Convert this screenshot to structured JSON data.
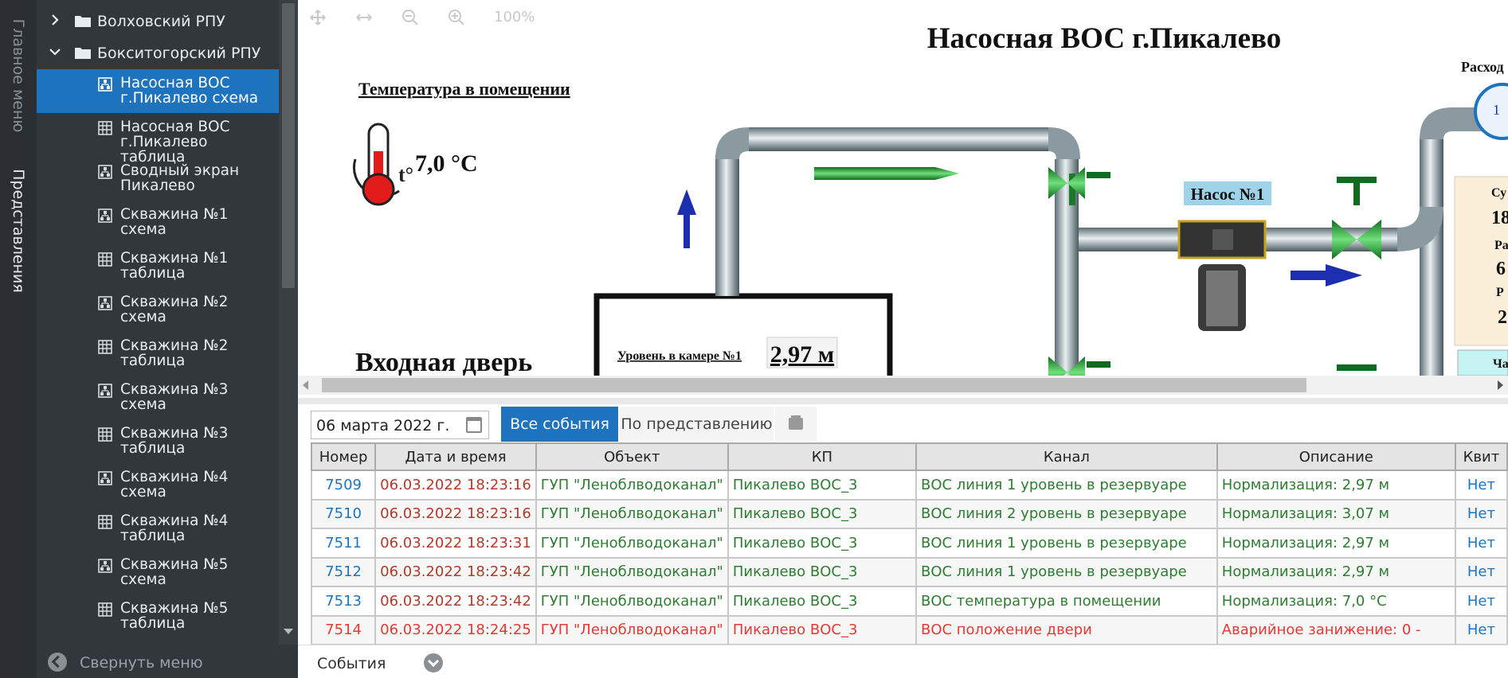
{
  "rail": {
    "main_menu": "Главное меню",
    "views": "Представления"
  },
  "tree": {
    "folders": [
      {
        "label": "Волховский РПУ",
        "expanded": false
      },
      {
        "label": "Бокситогорский РПУ",
        "expanded": true
      }
    ],
    "items": [
      {
        "label": "Насосная ВОС г.Пикалево схема",
        "icon": "scheme-icon",
        "active": true
      },
      {
        "label": "Насосная ВОС г.Пикалево таблица",
        "icon": "table-icon"
      },
      {
        "label": "Сводный экран Пикалево",
        "icon": "scheme-icon"
      },
      {
        "label": "Скважина №1 схема",
        "icon": "scheme-icon"
      },
      {
        "label": "Скважина №1 таблица",
        "icon": "table-icon"
      },
      {
        "label": "Скважина №2 схема",
        "icon": "scheme-icon"
      },
      {
        "label": "Скважина №2 таблица",
        "icon": "table-icon"
      },
      {
        "label": "Скважина №3 схема",
        "icon": "scheme-icon"
      },
      {
        "label": "Скважина №3 таблица",
        "icon": "table-icon"
      },
      {
        "label": "Скважина №4 схема",
        "icon": "scheme-icon"
      },
      {
        "label": "Скважина №4 таблица",
        "icon": "table-icon"
      },
      {
        "label": "Скважина №5 схема",
        "icon": "scheme-icon"
      },
      {
        "label": "Скважина №5 таблица",
        "icon": "table-icon"
      }
    ],
    "collapse_label": "Свернуть меню"
  },
  "canvas": {
    "zoom": "100%",
    "title": "Насосная ВОС г.Пикалево",
    "temp_title": "Температура в помещении",
    "temp_symbol": "t°",
    "temp_value": "7,0 °C",
    "pump_label": "Насос №1",
    "door_label": "Входная дверь",
    "level_label": "Уровень в камере №1",
    "level_value": "2,97 м",
    "flow_label_partial": "Расход",
    "side_panel": [
      "Су",
      "18",
      "Ра",
      "6",
      "Р",
      "2"
    ],
    "side_panel_bottom": "Ча",
    "gauge_partial": "1"
  },
  "events": {
    "date": "06 марта 2022 г.",
    "tab_all": "Все события",
    "tab_view": "По представлению",
    "columns": [
      "Номер",
      "Дата и время",
      "Объект",
      "КП",
      "Канал",
      "Описание",
      "Квит"
    ],
    "rows": [
      {
        "num": "7509",
        "dt": "06.03.2022 18:23:16",
        "obj": "ГУП \"Леноблводоканал\"",
        "kp": "Пикалево ВОС_3",
        "channel": "ВОС линия 1 уровень в резервуаре",
        "desc": "Нормализация: 2,97 м",
        "kvit": "Нет",
        "type": "norm"
      },
      {
        "num": "7510",
        "dt": "06.03.2022 18:23:16",
        "obj": "ГУП \"Леноблводоканал\"",
        "kp": "Пикалево ВОС_3",
        "channel": "ВОС линия 2 уровень в резервуаре",
        "desc": "Нормализация: 3,07 м",
        "kvit": "Нет",
        "type": "norm"
      },
      {
        "num": "7511",
        "dt": "06.03.2022 18:23:31",
        "obj": "ГУП \"Леноблводоканал\"",
        "kp": "Пикалево ВОС_3",
        "channel": "ВОС линия 1 уровень в резервуаре",
        "desc": "Нормализация: 2,97 м",
        "kvit": "Нет",
        "type": "norm"
      },
      {
        "num": "7512",
        "dt": "06.03.2022 18:23:42",
        "obj": "ГУП \"Леноблводоканал\"",
        "kp": "Пикалево ВОС_3",
        "channel": "ВОС линия 1 уровень в резервуаре",
        "desc": "Нормализация: 2,97 м",
        "kvit": "Нет",
        "type": "norm"
      },
      {
        "num": "7513",
        "dt": "06.03.2022 18:23:42",
        "obj": "ГУП \"Леноблводоканал\"",
        "kp": "Пикалево ВОС_3",
        "channel": "ВОС температура в помещении",
        "desc": "Нормализация: 7,0 °C",
        "kvit": "Нет",
        "type": "norm"
      },
      {
        "num": "7514",
        "dt": "06.03.2022 18:24:25",
        "obj": "ГУП \"Леноблводоканал\"",
        "kp": "Пикалево ВОС_3",
        "channel": "ВОС положение двери",
        "desc": "Аварийное занижение: 0 -",
        "kvit": "Нет",
        "type": "alarm"
      }
    ],
    "footer_label": "События"
  },
  "colors": {
    "accent": "#1e73be",
    "sidebar_bg": "#32373c",
    "rail_bg": "#2b2f33",
    "normal_text": "#2e7d32",
    "alarm_text": "#e53935"
  }
}
